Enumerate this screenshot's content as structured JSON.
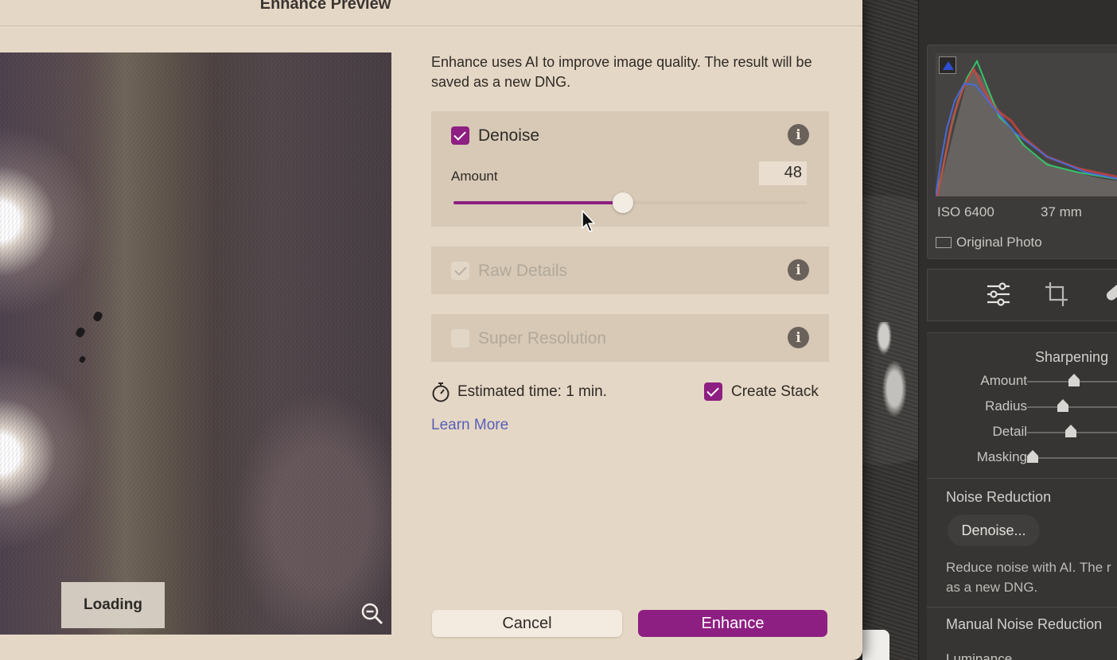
{
  "dialog": {
    "title": "Enhance Preview",
    "intro": "Enhance uses AI to improve image quality. The result will be saved as a new DNG.",
    "preview": {
      "loading_label": "Loading",
      "zoom_icon": "zoom-out-icon"
    },
    "options": {
      "denoise": {
        "label": "Denoise",
        "checked": true,
        "amount_label": "Amount",
        "amount_value": "48",
        "amount_max": 100
      },
      "raw_details": {
        "label": "Raw Details",
        "checked": true,
        "disabled": true
      },
      "super_resolution": {
        "label": "Super Resolution",
        "checked": false,
        "disabled": true
      }
    },
    "estimated_time": "Estimated time: 1 min.",
    "create_stack": {
      "label": "Create Stack",
      "checked": true
    },
    "learn_more": "Learn More",
    "buttons": {
      "cancel": "Cancel",
      "enhance": "Enhance"
    },
    "colors": {
      "accent": "#8e1f82",
      "link": "#5860b8",
      "background": "#e5d7c5"
    }
  },
  "lightroom_panel": {
    "iso": "ISO 6400",
    "focal_length": "37 mm",
    "original_photo": "Original Photo",
    "sharpening": {
      "title": "Sharpening",
      "sliders": [
        {
          "label": "Amount",
          "level": 0.5
        },
        {
          "label": "Radius",
          "level": 0.38
        },
        {
          "label": "Detail",
          "level": 0.47
        },
        {
          "label": "Masking",
          "level": 0.0
        }
      ]
    },
    "noise_reduction": {
      "title": "Noise Reduction",
      "button": "Denoise...",
      "description_line1": "Reduce noise with AI. The r",
      "description_line2": "as a new DNG."
    },
    "manual_noise_reduction": "Manual Noise Reduction",
    "luminance": "Luminance"
  }
}
